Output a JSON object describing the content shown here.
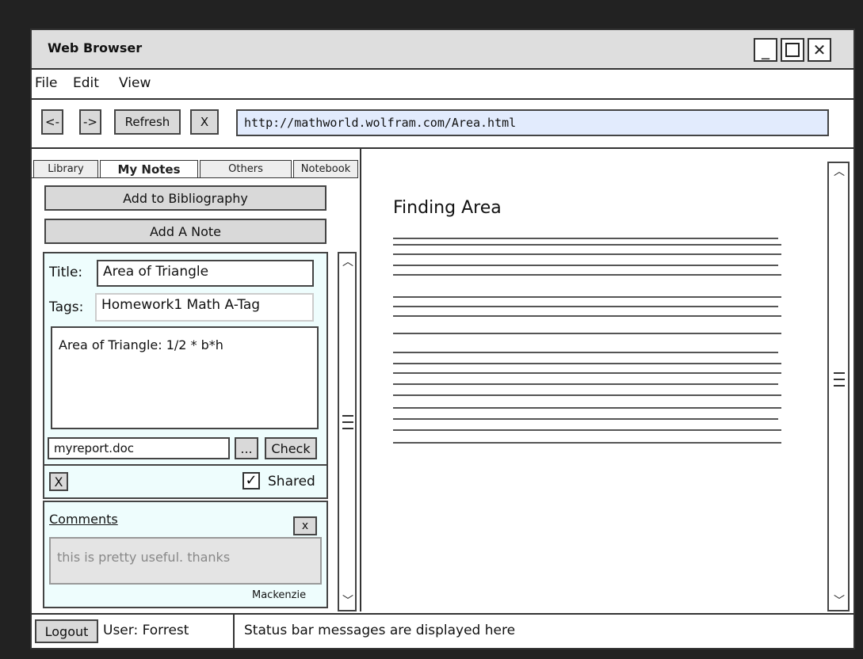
{
  "window": {
    "title": "Web Browser"
  },
  "menu": {
    "items": [
      "File",
      "Edit",
      "View"
    ]
  },
  "toolbar": {
    "back_label": "<-",
    "forward_label": "->",
    "refresh_label": "Refresh",
    "stop_label": "X",
    "url": "http://mathworld.wolfram.com/Area.html"
  },
  "sidebar": {
    "tabs": [
      "Library",
      "My Notes",
      "Others",
      "Notebook"
    ],
    "active_tab": "My Notes",
    "add_bibliography_label": "Add to Bibliography",
    "add_note_label": "Add A Note",
    "note": {
      "title_label": "Title:",
      "title_value": "Area of Triangle",
      "tags_label": "Tags:",
      "tags_value": "Homework1  Math  A-Tag",
      "body": "Area of Triangle: 1/2 * b*h",
      "file_value": "myreport.doc",
      "browse_label": "...",
      "check_label": "Check",
      "delete_label": "X",
      "shared_label": "Shared",
      "shared_checked": true
    },
    "comments": {
      "heading": "Comments",
      "close_label": "x",
      "text": "this is pretty useful. thanks",
      "author": "Mackenzie"
    }
  },
  "page": {
    "title": "Finding Area"
  },
  "status": {
    "logout_label": "Logout",
    "user_label": "User: Forrest",
    "message": "Status bar messages are displayed here"
  }
}
